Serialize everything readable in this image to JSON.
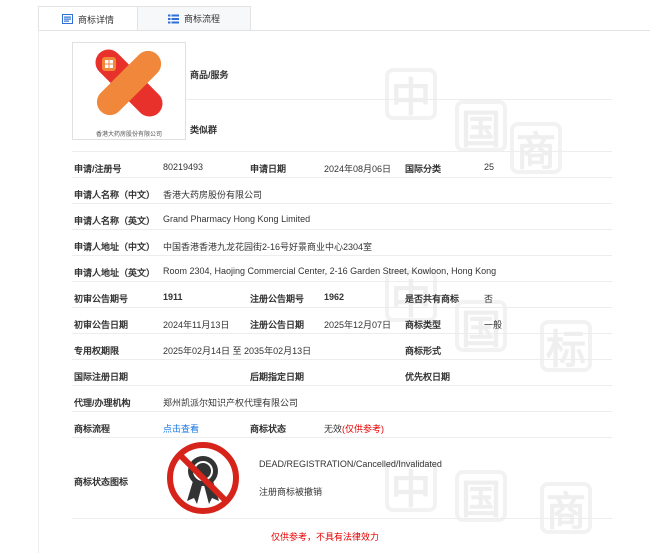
{
  "tabs": [
    {
      "label": "商标详情",
      "icon": "document-icon",
      "active": true
    },
    {
      "label": "商标流程",
      "icon": "list-icon",
      "active": false
    }
  ],
  "logo": {
    "caption": "香港大药房股份有限公司",
    "watermark": "中国商标网"
  },
  "goods_services_label": "商品/服务",
  "similar_group_label": "类似群",
  "fields": {
    "reg_no_label": "申请/注册号",
    "reg_no": "80219493",
    "apply_date_label": "申请日期",
    "apply_date": "2024年08月06日",
    "intl_class_label": "国际分类",
    "intl_class": "25",
    "applicant_cn_label": "申请人名称（中文）",
    "applicant_cn": "香港大药房股份有限公司",
    "applicant_en_label": "申请人名称（英文）",
    "applicant_en": "Grand Pharmacy Hong Kong Limited",
    "address_cn_label": "申请人地址（中文）",
    "address_cn": "中国香港香港九龙花园街2-16号好景商业中心2304室",
    "address_en_label": "申请人地址（英文）",
    "address_en": "Room 2304, Haojing Commercial Center, 2-16 Garden Street, Kowloon, Hong Kong",
    "prelim_issue_label": "初审公告期号",
    "prelim_issue": "1911",
    "reg_issue_label": "注册公告期号",
    "reg_issue": "1962",
    "shared_label": "是否共有商标",
    "shared": "否",
    "prelim_date_label": "初审公告日期",
    "prelim_date": "2024年11月13日",
    "reg_date_label": "注册公告日期",
    "reg_date": "2025年12月07日",
    "tm_type_label": "商标类型",
    "tm_type": "一般",
    "exclusive_label": "专用权期限",
    "exclusive": "2025年02月14日 至 2035年02月13日",
    "tm_form_label": "商标形式",
    "intl_reg_date_label": "国际注册日期",
    "later_date_label": "后期指定日期",
    "priority_date_label": "优先权日期",
    "agent_label": "代理/办理机构",
    "agent": "郑州凯派尔知识产权代理有限公司",
    "process_label": "商标流程",
    "process_link": "点击查看",
    "status_label": "商标状态",
    "status": "无效",
    "status_note": "(仅供参考)",
    "status_icon_label": "商标状态图标",
    "status_en": "DEAD/REGISTRATION/Cancelled/Invalidated",
    "status_cn": "注册商标被撤销"
  },
  "footer_note": "仅供参考，不具有法律效力",
  "watermark_chars": [
    "中",
    "国",
    "商",
    "标"
  ],
  "colors": {
    "link": "#1677e5",
    "red": "#e60000",
    "logo_orange": "#f0873a",
    "logo_red": "#e8312b"
  }
}
